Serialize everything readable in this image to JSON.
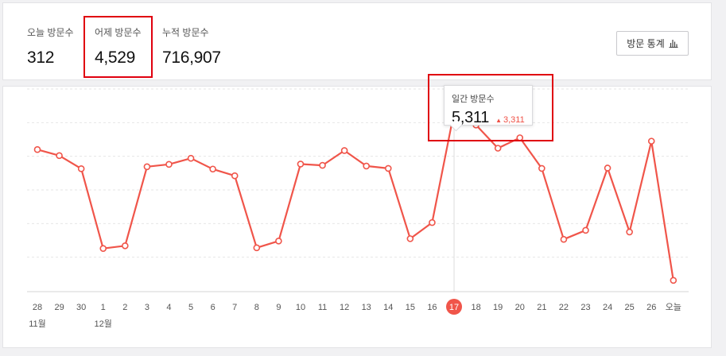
{
  "summary": {
    "today": {
      "label": "오늘 방문수",
      "value": "312"
    },
    "yesterday": {
      "label": "어제 방문수",
      "value": "4,529"
    },
    "total": {
      "label": "누적 방문수",
      "value": "716,907"
    }
  },
  "stats_button": {
    "label": "방문 통계",
    "icon": "bar-chart-icon"
  },
  "tooltip": {
    "label": "일간 방문수",
    "value": "5,311",
    "change": "3,311",
    "change_icon": "up-triangle-icon"
  },
  "colors": {
    "line": "#f0554a",
    "highlight_box": "#e0000f",
    "grid": "#e6e6e6"
  },
  "chart_data": {
    "type": "line",
    "title": "",
    "xlabel": "",
    "ylabel": "",
    "categories": [
      "28",
      "29",
      "30",
      "1",
      "2",
      "3",
      "4",
      "5",
      "6",
      "7",
      "8",
      "9",
      "10",
      "11",
      "12",
      "13",
      "14",
      "15",
      "16",
      "17",
      "18",
      "19",
      "20",
      "21",
      "22",
      "23",
      "24",
      "25",
      "26",
      "오늘"
    ],
    "month_labels": [
      {
        "category_index": 0,
        "text": "11월"
      },
      {
        "category_index": 3,
        "text": "12월"
      }
    ],
    "values": [
      4200,
      4020,
      3630,
      1260,
      1340,
      3690,
      3760,
      3940,
      3620,
      3420,
      1280,
      1480,
      3770,
      3730,
      4170,
      3710,
      3640,
      1550,
      2030,
      5311,
      4930,
      4240,
      4550,
      3640,
      1530,
      1800,
      3650,
      1750,
      4450,
      312
    ],
    "highlight_index": 19,
    "ylim": [
      0,
      6000
    ],
    "grid": true,
    "y_tick_labels_visible": false
  }
}
